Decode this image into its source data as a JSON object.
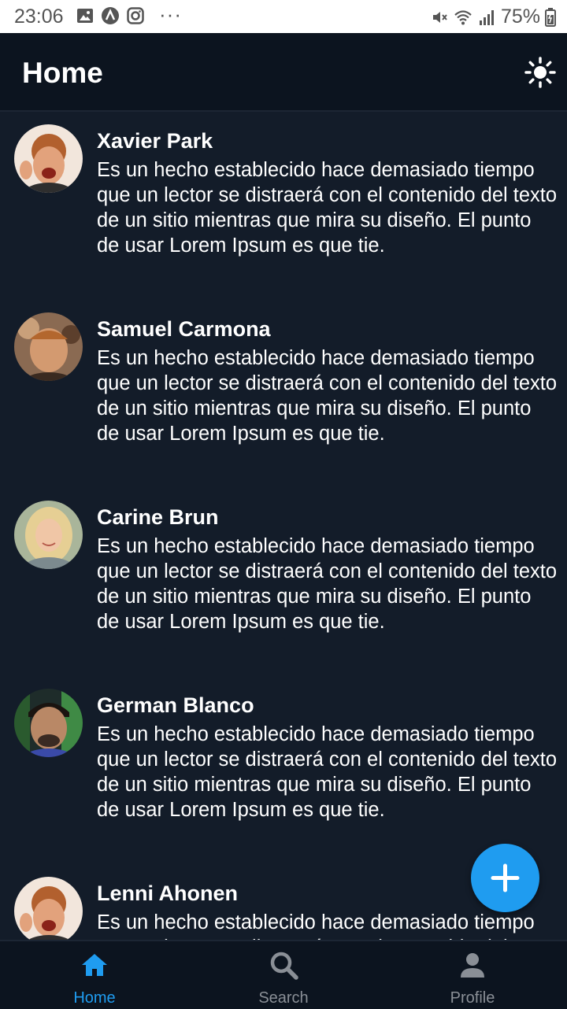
{
  "status_bar": {
    "time": "23:06",
    "left_icons": [
      "image-icon",
      "app-icon",
      "instagram-icon"
    ],
    "more": "···",
    "right_icons": [
      "mute-icon",
      "wifi-icon",
      "signal-icon"
    ],
    "battery": "75%"
  },
  "header": {
    "title": "Home",
    "theme_toggle_icon": "sun-icon"
  },
  "posts": [
    {
      "name": "Xavier Park",
      "text": "Es un hecho establecido hace demasiado tiempo que un lector se distraerá con el contenido del texto de un sitio mientras que mira su diseño. El punto de usar Lorem Ipsum es que tie."
    },
    {
      "name": "Samuel Carmona",
      "text": "Es un hecho establecido hace demasiado tiempo que un lector se distraerá con el contenido del texto de un sitio mientras que mira su diseño. El punto de usar Lorem Ipsum es que tie."
    },
    {
      "name": "Carine Brun",
      "text": "Es un hecho establecido hace demasiado tiempo que un lector se distraerá con el contenido del texto de un sitio mientras que mira su diseño. El punto de usar Lorem Ipsum es que tie."
    },
    {
      "name": "German Blanco",
      "text": "Es un hecho establecido hace demasiado tiempo que un lector se distraerá con el contenido del texto de un sitio mientras que mira su diseño. El punto de usar Lorem Ipsum es que tie."
    },
    {
      "name": "Lenni Ahonen",
      "text": "Es un hecho establecido hace demasiado tiempo que un lector se distraerá con el contenido del texto de un sitio mientras que mira su diseño. El punto de usar Lorem Ipsum es que tie."
    }
  ],
  "fab": {
    "icon": "plus-icon"
  },
  "bottom_nav": {
    "items": [
      {
        "label": "Home",
        "icon": "home-icon",
        "active": true
      },
      {
        "label": "Search",
        "icon": "search-icon",
        "active": false
      },
      {
        "label": "Profile",
        "icon": "profile-icon",
        "active": false
      }
    ]
  },
  "colors": {
    "background": "#131c29",
    "header": "#0c141f",
    "accent": "#1f9cf0",
    "inactive": "#8a8f96"
  }
}
